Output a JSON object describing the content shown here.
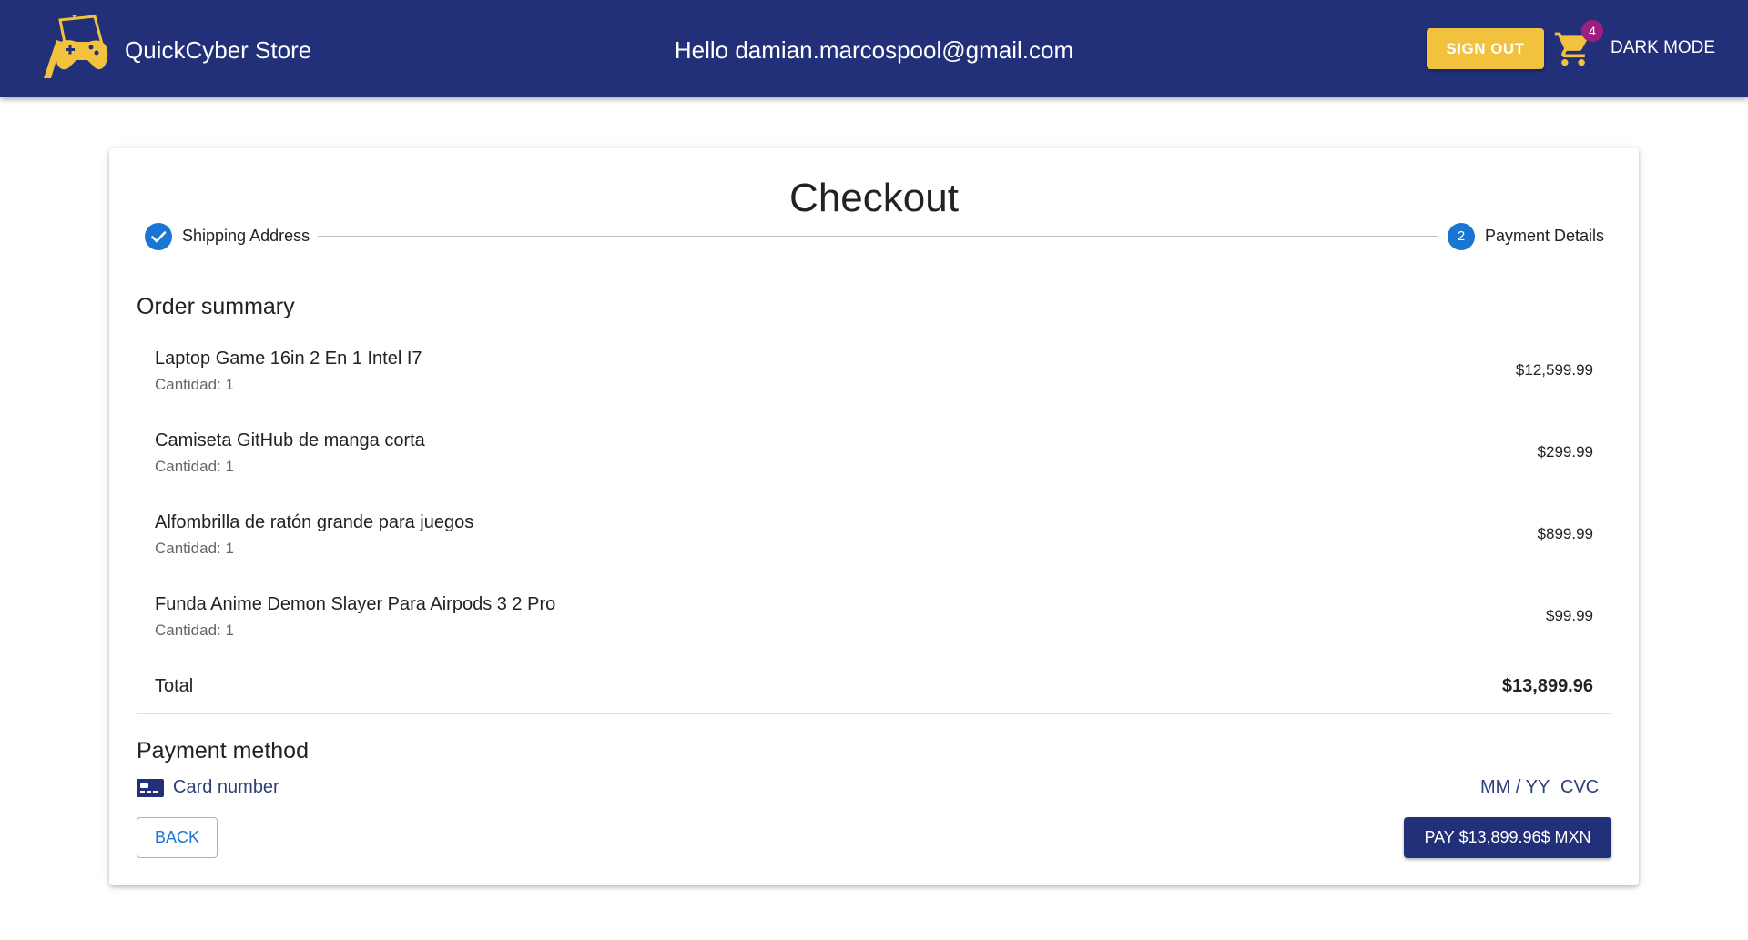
{
  "header": {
    "brand": "QuickCyber Store",
    "greeting": "Hello damian.marcospool@gmail.com",
    "sign_out": "SIGN OUT",
    "cart_count": "4",
    "dark_mode": "DARK MODE"
  },
  "colors": {
    "appbar": "#213079",
    "sign_out_button": "#f2c13e",
    "step_active": "#1976d2",
    "badge": "#9c1f7f",
    "pay_button": "#213079"
  },
  "checkout": {
    "title": "Checkout",
    "steps": [
      {
        "label": "Shipping Address",
        "state": "completed",
        "icon": "check-circle-icon"
      },
      {
        "label": "Payment Details",
        "state": "active",
        "number": "2"
      }
    ],
    "order_summary_title": "Order summary",
    "items": [
      {
        "name": "Laptop Game 16in 2 En 1 Intel I7",
        "quantity": "Cantidad: 1",
        "price": "$12,599.99"
      },
      {
        "name": "Camiseta GitHub de manga corta",
        "quantity": "Cantidad: 1",
        "price": "$299.99"
      },
      {
        "name": "Alfombrilla de ratón grande para juegos",
        "quantity": "Cantidad: 1",
        "price": "$899.99"
      },
      {
        "name": "Funda Anime Demon Slayer Para Airpods 3 2 Pro",
        "quantity": "Cantidad: 1",
        "price": "$99.99"
      }
    ],
    "total_label": "Total",
    "total_value": "$13,899.96",
    "payment_method_title": "Payment method",
    "card_number_placeholder": "Card number",
    "expiry_placeholder": "MM / YY",
    "cvc_placeholder": "CVC",
    "back_label": "BACK",
    "pay_label": "PAY $13,899.96$ MXN"
  }
}
